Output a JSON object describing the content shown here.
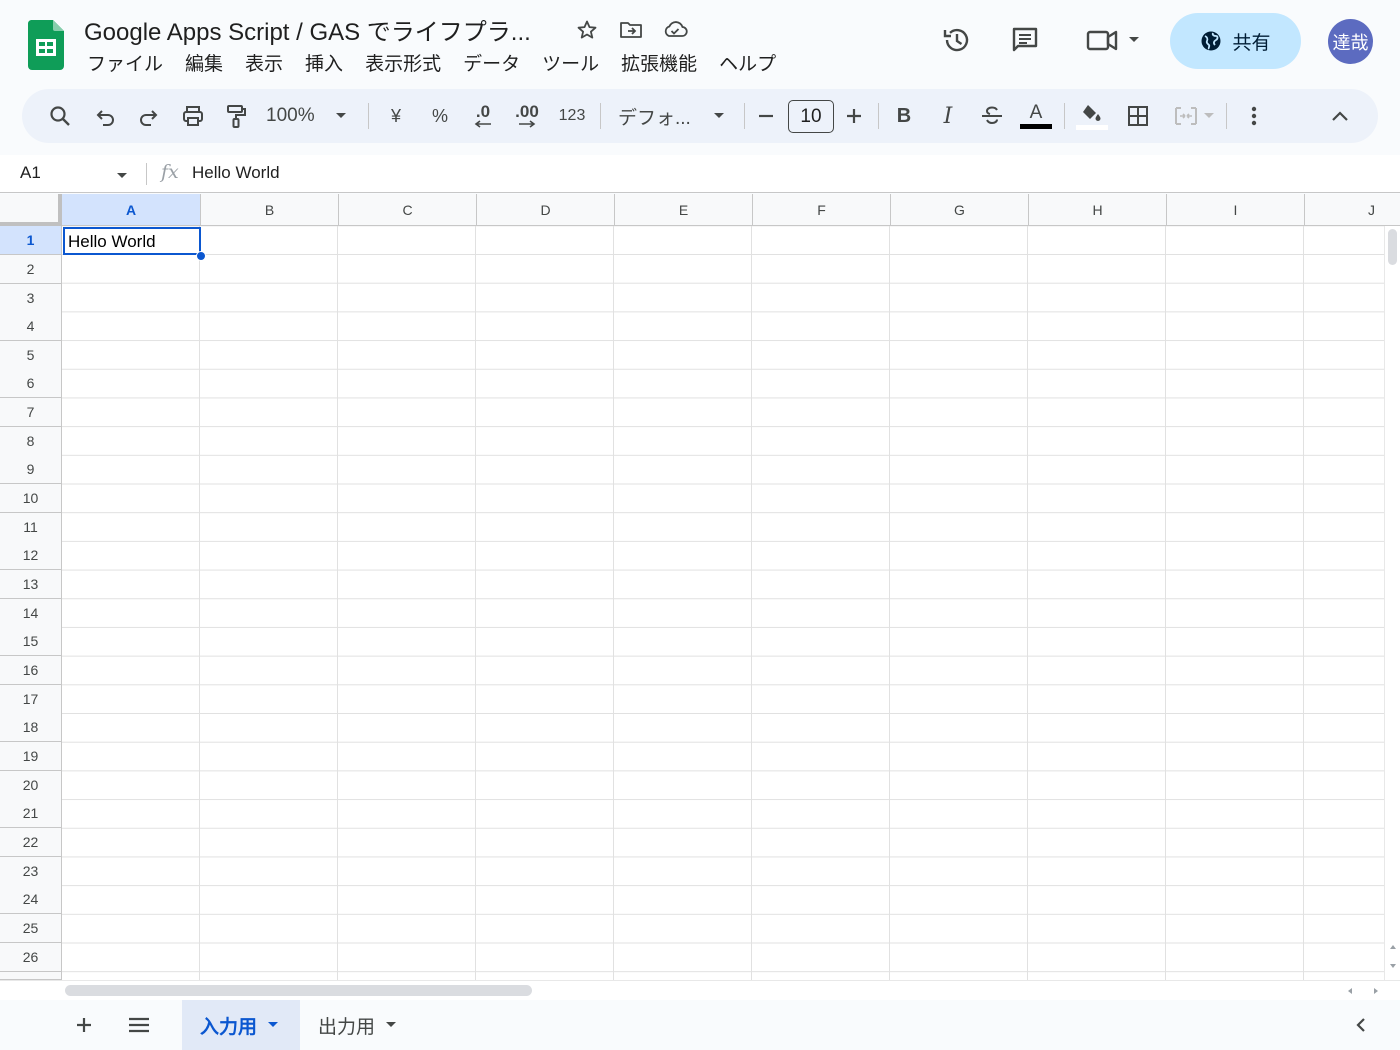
{
  "doc": {
    "title": "Google Apps Script / GAS でライフプラ..."
  },
  "menu": [
    "ファイル",
    "編集",
    "表示",
    "挿入",
    "表示形式",
    "データ",
    "ツール",
    "拡張機能",
    "ヘルプ"
  ],
  "header": {
    "share_label": "共有",
    "avatar_text": "達哉"
  },
  "toolbar": {
    "zoom": "100%",
    "currency": "¥",
    "percent": "%",
    "dec_decrease": ".0",
    "dec_increase": ".00",
    "number_format": "123",
    "font": "デフォ...",
    "font_size": "10",
    "bold": "B",
    "italic": "I",
    "text_color_letter": "A"
  },
  "formula_bar": {
    "cell_ref": "A1",
    "content": "Hello World"
  },
  "columns": [
    "A",
    "B",
    "C",
    "D",
    "E",
    "F",
    "G",
    "H",
    "I",
    "J"
  ],
  "rows": [
    "1",
    "2",
    "3",
    "4",
    "5",
    "6",
    "7",
    "8",
    "9",
    "10",
    "11",
    "12",
    "13",
    "14",
    "15",
    "16",
    "17",
    "18",
    "19",
    "20",
    "21",
    "22",
    "23",
    "24",
    "25",
    "26"
  ],
  "cells": {
    "A1": "Hello World"
  },
  "sheets": [
    {
      "name": "入力用",
      "active": true
    },
    {
      "name": "出力用",
      "active": false
    }
  ],
  "colors": {
    "accent": "#0b57d0",
    "share_bg": "#c2e7ff",
    "sheets_green": "#0f9d58",
    "avatar_bg": "#5c6bc0"
  }
}
